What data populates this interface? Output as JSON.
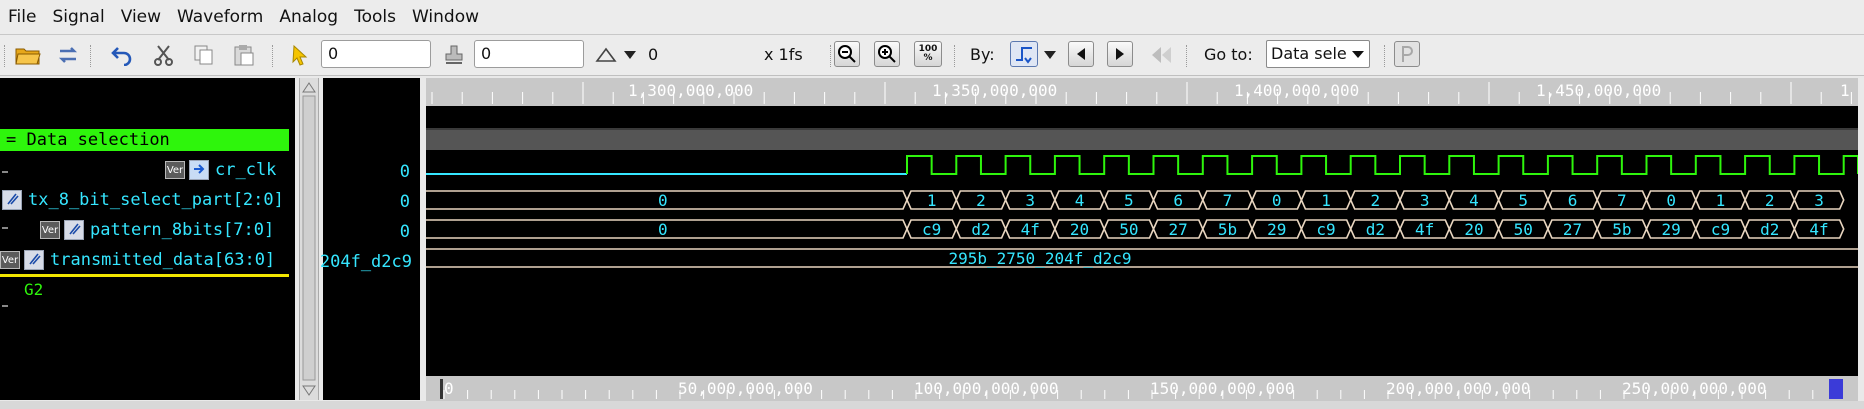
{
  "menu": [
    {
      "label": "File"
    },
    {
      "label": "Signal"
    },
    {
      "label": "View"
    },
    {
      "label": "Waveform"
    },
    {
      "label": "Analog"
    },
    {
      "label": "Tools"
    },
    {
      "label": "Window"
    }
  ],
  "toolbar": {
    "cursor_time": "0",
    "marker_time": "0",
    "delta_value": "0",
    "scale": "x 1fs",
    "by_label": "By:",
    "goto_label": "Go to:",
    "goto_selected": "Data sele",
    "zoom_full_label": "100 %"
  },
  "signals": {
    "group_name": "Data selection",
    "rows": [
      {
        "name": "cr_clk",
        "value": "0"
      },
      {
        "name": "tx_8_bit_select_part[2:0]",
        "value": "0"
      },
      {
        "name": "pattern_8bits[7:0]",
        "value": "0"
      },
      {
        "name": "transmitted_data[63:0]",
        "value": "204f_d2c9"
      }
    ],
    "badge_text": "Ver",
    "next_group": "G2"
  },
  "waveform": {
    "top_ruler_labels": [
      "1,300,000,000",
      "1,350,000,000",
      "1,400,000,000",
      "1,450,000,000",
      "1"
    ],
    "bottom_ruler_labels": [
      "0",
      "50,000,000,000",
      "100,000,000,000",
      "150,000,000,000",
      "200,000,000,000",
      "250,000,000,000"
    ],
    "tx_initial": "0",
    "tx_values": [
      "1",
      "2",
      "3",
      "4",
      "5",
      "6",
      "7",
      "0",
      "1",
      "2",
      "3",
      "4",
      "5",
      "6",
      "7",
      "0",
      "1",
      "2",
      "3"
    ],
    "pattern_initial": "0",
    "pattern_values": [
      "c9",
      "d2",
      "4f",
      "20",
      "50",
      "27",
      "5b",
      "29",
      "c9",
      "d2",
      "4f",
      "20",
      "50",
      "27",
      "5b",
      "29",
      "c9",
      "d2",
      "4f"
    ],
    "transmitted_value": "295b_2750_204f_d2c9"
  },
  "colors": {
    "wave_green": "#2ef50c",
    "wave_bus": "#e9d6c0",
    "clock_low": "#35e6ff",
    "value_text": "#35e6ff",
    "group_bg": "#2ef50c"
  }
}
